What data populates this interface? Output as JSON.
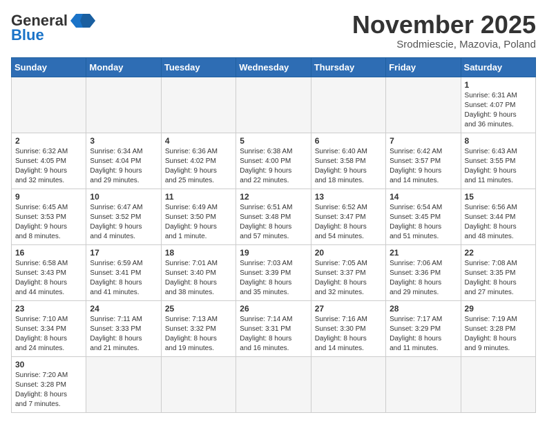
{
  "header": {
    "logo_general": "General",
    "logo_blue": "Blue",
    "month_title": "November 2025",
    "subtitle": "Srodmiescie, Mazovia, Poland"
  },
  "weekdays": [
    "Sunday",
    "Monday",
    "Tuesday",
    "Wednesday",
    "Thursday",
    "Friday",
    "Saturday"
  ],
  "weeks": [
    [
      {
        "day": "",
        "empty": true
      },
      {
        "day": "",
        "empty": true
      },
      {
        "day": "",
        "empty": true
      },
      {
        "day": "",
        "empty": true
      },
      {
        "day": "",
        "empty": true
      },
      {
        "day": "",
        "empty": true
      },
      {
        "day": "1",
        "info": "Sunrise: 6:31 AM\nSunset: 4:07 PM\nDaylight: 9 hours\nand 36 minutes."
      }
    ],
    [
      {
        "day": "2",
        "info": "Sunrise: 6:32 AM\nSunset: 4:05 PM\nDaylight: 9 hours\nand 32 minutes."
      },
      {
        "day": "3",
        "info": "Sunrise: 6:34 AM\nSunset: 4:04 PM\nDaylight: 9 hours\nand 29 minutes."
      },
      {
        "day": "4",
        "info": "Sunrise: 6:36 AM\nSunset: 4:02 PM\nDaylight: 9 hours\nand 25 minutes."
      },
      {
        "day": "5",
        "info": "Sunrise: 6:38 AM\nSunset: 4:00 PM\nDaylight: 9 hours\nand 22 minutes."
      },
      {
        "day": "6",
        "info": "Sunrise: 6:40 AM\nSunset: 3:58 PM\nDaylight: 9 hours\nand 18 minutes."
      },
      {
        "day": "7",
        "info": "Sunrise: 6:42 AM\nSunset: 3:57 PM\nDaylight: 9 hours\nand 14 minutes."
      },
      {
        "day": "8",
        "info": "Sunrise: 6:43 AM\nSunset: 3:55 PM\nDaylight: 9 hours\nand 11 minutes."
      }
    ],
    [
      {
        "day": "9",
        "info": "Sunrise: 6:45 AM\nSunset: 3:53 PM\nDaylight: 9 hours\nand 8 minutes."
      },
      {
        "day": "10",
        "info": "Sunrise: 6:47 AM\nSunset: 3:52 PM\nDaylight: 9 hours\nand 4 minutes."
      },
      {
        "day": "11",
        "info": "Sunrise: 6:49 AM\nSunset: 3:50 PM\nDaylight: 9 hours\nand 1 minute."
      },
      {
        "day": "12",
        "info": "Sunrise: 6:51 AM\nSunset: 3:48 PM\nDaylight: 8 hours\nand 57 minutes."
      },
      {
        "day": "13",
        "info": "Sunrise: 6:52 AM\nSunset: 3:47 PM\nDaylight: 8 hours\nand 54 minutes."
      },
      {
        "day": "14",
        "info": "Sunrise: 6:54 AM\nSunset: 3:45 PM\nDaylight: 8 hours\nand 51 minutes."
      },
      {
        "day": "15",
        "info": "Sunrise: 6:56 AM\nSunset: 3:44 PM\nDaylight: 8 hours\nand 48 minutes."
      }
    ],
    [
      {
        "day": "16",
        "info": "Sunrise: 6:58 AM\nSunset: 3:43 PM\nDaylight: 8 hours\nand 44 minutes."
      },
      {
        "day": "17",
        "info": "Sunrise: 6:59 AM\nSunset: 3:41 PM\nDaylight: 8 hours\nand 41 minutes."
      },
      {
        "day": "18",
        "info": "Sunrise: 7:01 AM\nSunset: 3:40 PM\nDaylight: 8 hours\nand 38 minutes."
      },
      {
        "day": "19",
        "info": "Sunrise: 7:03 AM\nSunset: 3:39 PM\nDaylight: 8 hours\nand 35 minutes."
      },
      {
        "day": "20",
        "info": "Sunrise: 7:05 AM\nSunset: 3:37 PM\nDaylight: 8 hours\nand 32 minutes."
      },
      {
        "day": "21",
        "info": "Sunrise: 7:06 AM\nSunset: 3:36 PM\nDaylight: 8 hours\nand 29 minutes."
      },
      {
        "day": "22",
        "info": "Sunrise: 7:08 AM\nSunset: 3:35 PM\nDaylight: 8 hours\nand 27 minutes."
      }
    ],
    [
      {
        "day": "23",
        "info": "Sunrise: 7:10 AM\nSunset: 3:34 PM\nDaylight: 8 hours\nand 24 minutes."
      },
      {
        "day": "24",
        "info": "Sunrise: 7:11 AM\nSunset: 3:33 PM\nDaylight: 8 hours\nand 21 minutes."
      },
      {
        "day": "25",
        "info": "Sunrise: 7:13 AM\nSunset: 3:32 PM\nDaylight: 8 hours\nand 19 minutes."
      },
      {
        "day": "26",
        "info": "Sunrise: 7:14 AM\nSunset: 3:31 PM\nDaylight: 8 hours\nand 16 minutes."
      },
      {
        "day": "27",
        "info": "Sunrise: 7:16 AM\nSunset: 3:30 PM\nDaylight: 8 hours\nand 14 minutes."
      },
      {
        "day": "28",
        "info": "Sunrise: 7:17 AM\nSunset: 3:29 PM\nDaylight: 8 hours\nand 11 minutes."
      },
      {
        "day": "29",
        "info": "Sunrise: 7:19 AM\nSunset: 3:28 PM\nDaylight: 8 hours\nand 9 minutes."
      }
    ],
    [
      {
        "day": "30",
        "info": "Sunrise: 7:20 AM\nSunset: 3:28 PM\nDaylight: 8 hours\nand 7 minutes."
      },
      {
        "day": "",
        "empty": true
      },
      {
        "day": "",
        "empty": true
      },
      {
        "day": "",
        "empty": true
      },
      {
        "day": "",
        "empty": true
      },
      {
        "day": "",
        "empty": true
      },
      {
        "day": "",
        "empty": true
      }
    ]
  ]
}
